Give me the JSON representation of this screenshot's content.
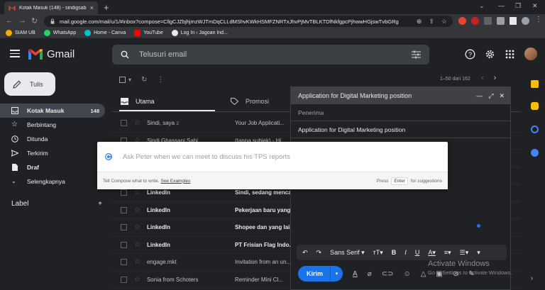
{
  "browser": {
    "tab_title": "Kotak Masuk (148) - sindigsabila...",
    "url": "mail.google.com/mail/u/1/#inbox?compose=CllgCJZbjhjmzWJTmDqCLLdMShvKWkHSMFZNRTxJhvPjMvTBLKTDfNkfgpcPjhwwHGjswTvbGRg",
    "bookmarks": [
      "SIAM UB",
      "WhatsApp",
      "Home - Canva",
      "YouTube",
      "Log In ‹ Jagoan Ind..."
    ]
  },
  "gmail": {
    "logo_text": "Gmail",
    "search_placeholder": "Telusuri email",
    "compose_label": "Tulis",
    "nav": [
      {
        "label": "Kotak Masuk",
        "count": "148"
      },
      {
        "label": "Berbintang"
      },
      {
        "label": "Ditunda"
      },
      {
        "label": "Terkirim"
      },
      {
        "label": "Draf"
      },
      {
        "label": "Selengkapnya"
      }
    ],
    "labels_heading": "Label",
    "pager": "1–50 dari 162",
    "categories": [
      "Utama",
      "Promosi"
    ],
    "rows": [
      {
        "sender": "Sindi, saya",
        "count": "2",
        "subject": "Your Job Applicati...",
        "unread": false
      },
      {
        "sender": "Sindi Ghassani Sabi...",
        "subject": "(tanpa subjek) - Hi...",
        "unread": false
      },
      {
        "sender": "",
        "subject": "",
        "unread": false
      },
      {
        "sender": "",
        "subject": "",
        "unread": false
      },
      {
        "sender": "LinkedIn",
        "subject": "Sindi, sedang mencari...",
        "unread": true
      },
      {
        "sender": "LinkedIn",
        "subject": "Pekerjaan baru yang...",
        "unread": true
      },
      {
        "sender": "LinkedIn",
        "subject": "Shopee dan yang lain...",
        "unread": true
      },
      {
        "sender": "LinkedIn",
        "subject": "PT Frisian Flag Indo...",
        "unread": true
      },
      {
        "sender": "engage.mkt",
        "subject": "Invitation from an un...",
        "unread": false
      },
      {
        "sender": "Sonia from Schoters",
        "subject": "Reminder Mini Cl...",
        "unread": false
      }
    ]
  },
  "compose": {
    "title": "Application for Digital Marketing position",
    "to_placeholder": "Penerima",
    "subject": "Application for Digital Marketing position",
    "font": "Sans Serif",
    "send_label": "Kirim"
  },
  "ai": {
    "placeholder": "Ask Peter when we can meet to discuss his TPS reports",
    "hint": "Tell Compose what to write.",
    "examples_link": "See Examples",
    "press": "Press",
    "key": "Enter",
    "suffix": "for suggestions"
  },
  "watermark": {
    "line1": "Activate Windows",
    "line2": "Go to Settings to activate Windows."
  },
  "colors": {
    "accent": "#1a73e8",
    "gmail_red": "#ea4335",
    "background": "#202124"
  }
}
